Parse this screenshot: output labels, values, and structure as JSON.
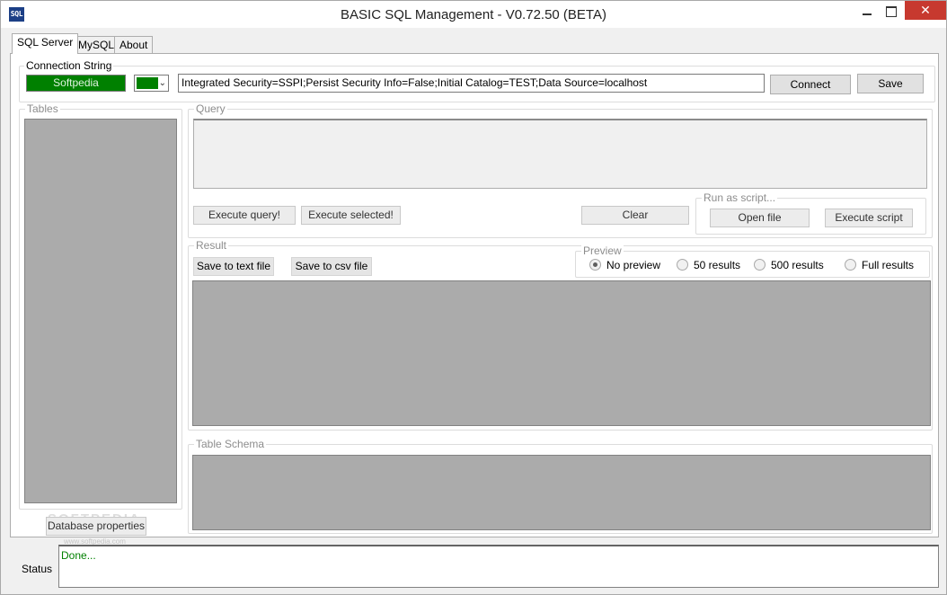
{
  "window": {
    "title": "BASIC SQL Management  - V0.72.50 (BETA)",
    "icon_text": "SQL",
    "close_glyph": "✕"
  },
  "tabs": [
    {
      "label": "SQL Server",
      "active": true
    },
    {
      "label": "MySQL",
      "active": false
    },
    {
      "label": "About",
      "active": false
    }
  ],
  "connection": {
    "group_label": "Connection String",
    "color_field_text": "Softpedia",
    "connection_string": "Integrated Security=SSPI;Persist Security Info=False;Initial Catalog=TEST;Data Source=localhost",
    "connect_label": "Connect",
    "save_label": "Save",
    "accent_color": "#008000"
  },
  "tables": {
    "group_label": "Tables",
    "db_properties_label": "Database properties"
  },
  "query": {
    "group_label": "Query",
    "execute_label": "Execute query!",
    "execute_selected_label": "Execute selected!",
    "clear_label": "Clear",
    "run_as_script": {
      "group_label": "Run as script...",
      "open_file_label": "Open file",
      "execute_script_label": "Execute script"
    }
  },
  "result": {
    "group_label": "Result",
    "save_text_label": "Save to text file",
    "save_csv_label": "Save to csv file",
    "preview": {
      "group_label": "Preview",
      "options": [
        {
          "label": "No preview",
          "checked": true
        },
        {
          "label": "50 results",
          "checked": false
        },
        {
          "label": "500 results",
          "checked": false
        },
        {
          "label": "Full results",
          "checked": false
        }
      ]
    }
  },
  "schema": {
    "group_label": "Table Schema"
  },
  "status": {
    "label": "Status",
    "text": "Done...",
    "text_color": "#008000"
  },
  "watermark": {
    "text": "SOFTPEDIA",
    "sub": "www.softpedia.com"
  }
}
